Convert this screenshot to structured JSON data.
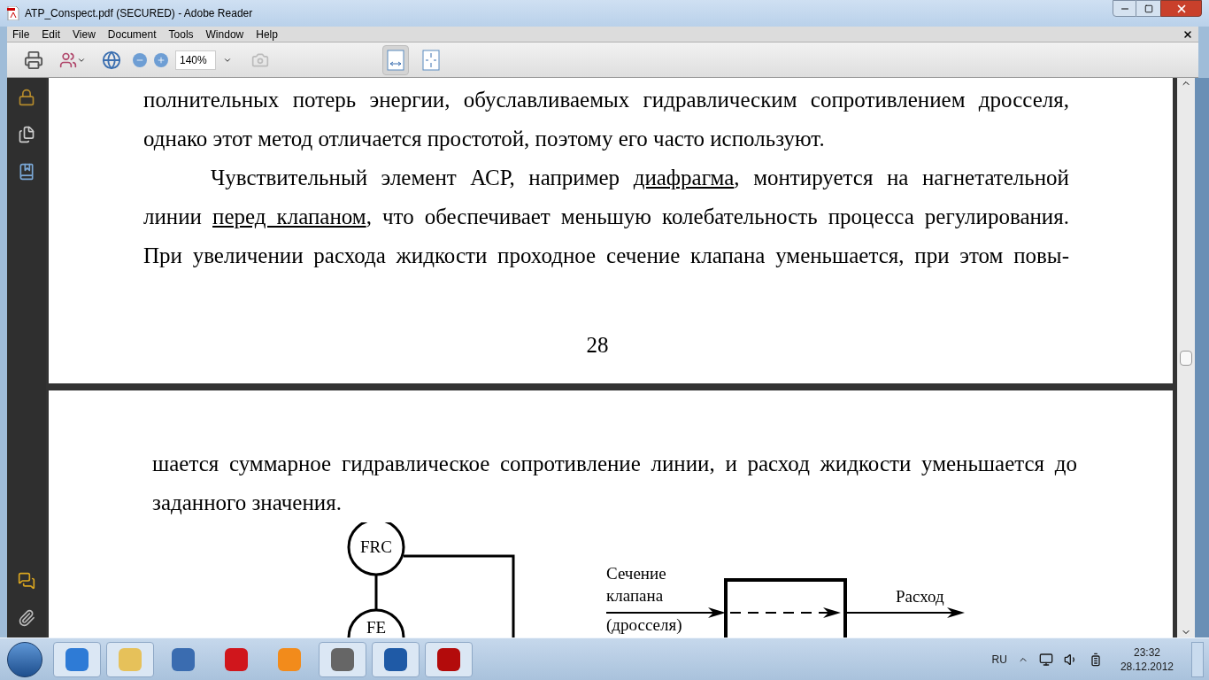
{
  "window": {
    "title": "ATP_Conspect.pdf (SECURED) - Adobe Reader"
  },
  "menu": [
    "File",
    "Edit",
    "View",
    "Document",
    "Tools",
    "Window",
    "Help"
  ],
  "toolbar": {
    "zoom": "140%",
    "view_buttons": [
      {
        "selected": true
      },
      {
        "selected": false
      }
    ]
  },
  "pages": [
    {
      "paragraphs": [
        {
          "indent": false,
          "continues": false,
          "segments": [
            {
              "kind": "plain",
              "text": "полнительных потерь энергии, обуславливаемых гидравлическим сопротивлением дросселя, однако этот метод отличается простотой, поэтому его часто используют."
            }
          ]
        },
        {
          "indent": true,
          "continues": true,
          "segments": [
            {
              "kind": "plain",
              "text": "Чувствительный элемент АСР, например "
            },
            {
              "kind": "underlined",
              "text": "диафрагма"
            },
            {
              "kind": "plain",
              "text": ", монтируется на нагнетательной линии "
            },
            {
              "kind": "underlined",
              "text": "перед клапаном"
            },
            {
              "kind": "plain",
              "text": ", что обеспечивает меньшую колебательность процесса регулирования. При увеличении расхода жидкости проходное сечение клапана уменьшается, при этом повы-"
            }
          ]
        }
      ],
      "page_number": "28"
    },
    {
      "paragraphs": [
        {
          "indent": false,
          "continues": false,
          "segments": [
            {
              "kind": "plain",
              "text": "шается суммарное гидравлическое сопротивление линии, и расход жидкости уменьшается до заданного значения."
            }
          ]
        }
      ]
    }
  ],
  "diagram": {
    "nodes": [
      "FRC",
      "FE"
    ],
    "input_label": [
      "Сечение",
      "клапана",
      "(дросселя)"
    ],
    "output_label": "Расход"
  },
  "taskbar": {
    "language": "RU",
    "time": "23:32",
    "date": "28.12.2012"
  }
}
